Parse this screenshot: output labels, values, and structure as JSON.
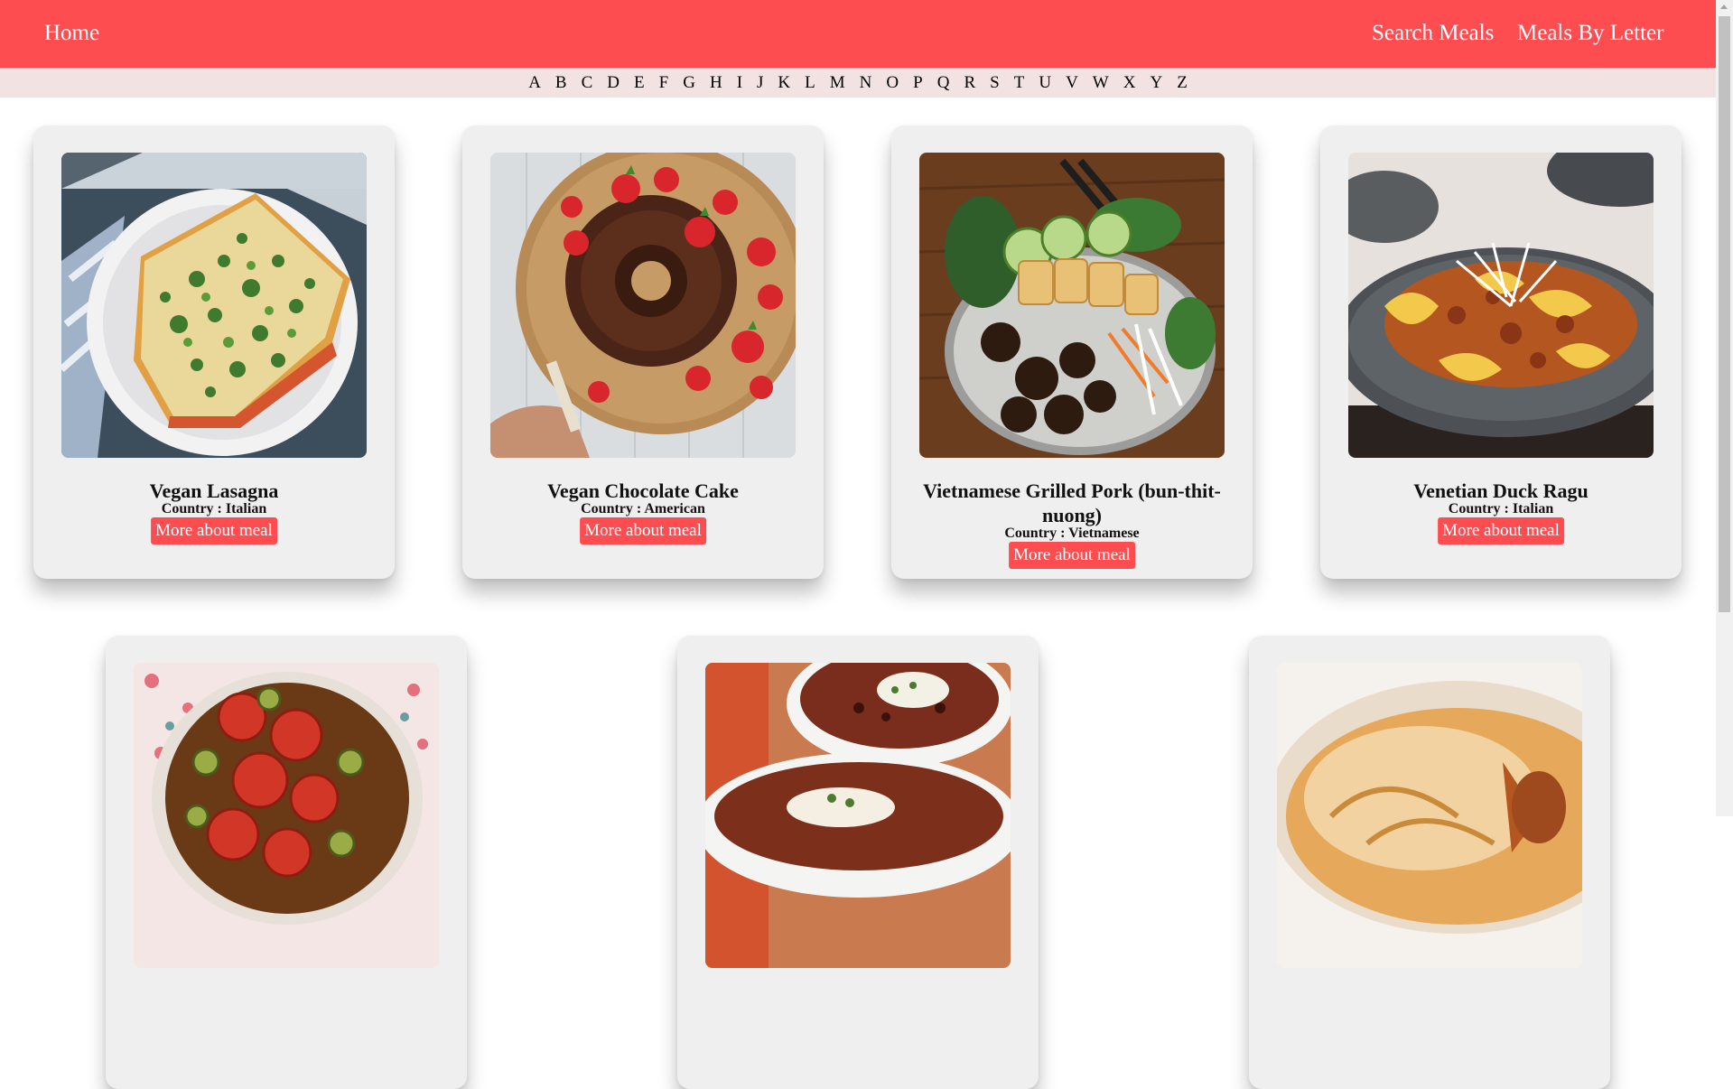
{
  "nav": {
    "home": "Home",
    "search_meals": "Search Meals",
    "meals_by_letter": "Meals By Letter"
  },
  "letters": [
    "A",
    "B",
    "C",
    "D",
    "E",
    "F",
    "G",
    "H",
    "I",
    "J",
    "K",
    "L",
    "M",
    "N",
    "O",
    "P",
    "Q",
    "R",
    "S",
    "T",
    "U",
    "V",
    "W",
    "X",
    "Y",
    "Z"
  ],
  "country_prefix": "Country : ",
  "meals": [
    {
      "name": "Vegan Lasagna",
      "country": "Country : Italian",
      "button": "More about meal"
    },
    {
      "name": "Vegan Chocolate Cake",
      "country": "Country : American",
      "button": "More about meal"
    },
    {
      "name": "Vietnamese Grilled Pork (bun-thit-nuong)",
      "country": "Country : Vietnamese",
      "button": "More about meal"
    },
    {
      "name": "Venetian Duck Ragu",
      "country": "Country : Italian",
      "button": "More about meal"
    }
  ],
  "colors": {
    "accent": "#fe4d51",
    "letter_bar": "#f2e2e2",
    "card": "#efefef"
  }
}
